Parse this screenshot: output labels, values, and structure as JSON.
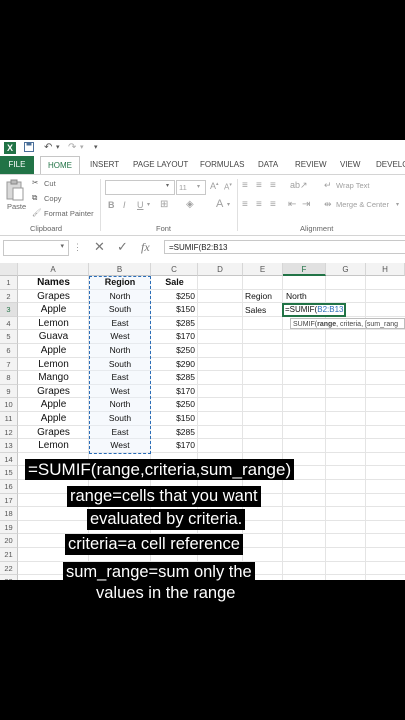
{
  "qat": {
    "icons": [
      "excel-logo",
      "save-icon",
      "undo-icon",
      "redo-icon",
      "customize-icon"
    ]
  },
  "tabs": [
    "FILE",
    "HOME",
    "INSERT",
    "PAGE LAYOUT",
    "FORMULAS",
    "DATA",
    "REVIEW",
    "VIEW",
    "DEVELOPER"
  ],
  "tab_display": [
    "FILE",
    "HOME",
    "INSERT",
    "PAGE LAYOUT",
    "FORMULAS",
    "DATA",
    "REVIEW",
    "VIEW",
    "DEVELO"
  ],
  "ribbon": {
    "clipboard": {
      "paste": "Paste",
      "cut": "Cut",
      "copy": "Copy",
      "format_painter": "Format Painter",
      "label": "Clipboard"
    },
    "font": {
      "size": "11",
      "bold": "B",
      "italic": "I",
      "underline": "U",
      "label": "Font"
    },
    "alignment": {
      "wrap_text": "Wrap Text",
      "merge_center": "Merge & Center",
      "label": "Alignment"
    }
  },
  "formula_bar": {
    "fx": "fx",
    "formula": "=SUMIF(B2:B13"
  },
  "columns": [
    "A",
    "B",
    "C",
    "D",
    "E",
    "F",
    "G",
    "H"
  ],
  "rows": [
    "1",
    "2",
    "3",
    "4",
    "5",
    "6",
    "7",
    "8",
    "9",
    "10",
    "11",
    "12",
    "13",
    "14",
    "15",
    "16",
    "17",
    "18",
    "19",
    "20",
    "21",
    "22",
    "23"
  ],
  "headers": {
    "names": "Names",
    "region": "Region",
    "sale": "Sale"
  },
  "table": [
    {
      "name": "Grapes",
      "region": "North",
      "sale": "$250"
    },
    {
      "name": "Apple",
      "region": "South",
      "sale": "$150"
    },
    {
      "name": "Lemon",
      "region": "East",
      "sale": "$285"
    },
    {
      "name": "Guava",
      "region": "West",
      "sale": "$170"
    },
    {
      "name": "Apple",
      "region": "North",
      "sale": "$250"
    },
    {
      "name": "Lemon",
      "region": "South",
      "sale": "$290"
    },
    {
      "name": "Mango",
      "region": "East",
      "sale": "$285"
    },
    {
      "name": "Grapes",
      "region": "West",
      "sale": "$170"
    },
    {
      "name": "Apple",
      "region": "North",
      "sale": "$250"
    },
    {
      "name": "Apple",
      "region": "South",
      "sale": "$150"
    },
    {
      "name": "Grapes",
      "region": "East",
      "sale": "$285"
    },
    {
      "name": "Lemon",
      "region": "West",
      "sale": "$170"
    }
  ],
  "criteria": {
    "region_label": "Region",
    "region_value": "North",
    "sales_label": "Sales"
  },
  "active_cell": {
    "prefix": "=SUMIF(",
    "ref": "B2:B13"
  },
  "tooltip": {
    "func": "SUMIF(",
    "arg1": "range",
    "rest": ", criteria, [sum_rang"
  },
  "captions": {
    "line1": "=SUMIF(range,criteria,sum_range)",
    "line2": "range=cells that you want",
    "line3": "evaluated by criteria.",
    "line4": "criteria=a cell reference",
    "line5": "sum_range=sum only the",
    "line6": "values in the range"
  },
  "colors": {
    "excel_green": "#217346",
    "caption_yellow": "#f5e13a",
    "selection_blue": "#2a6db8"
  }
}
